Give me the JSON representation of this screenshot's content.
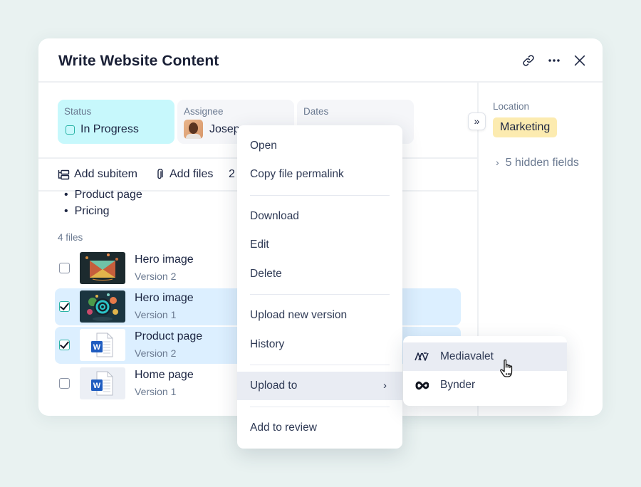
{
  "window": {
    "title": "Write Website Content",
    "actions": [
      {
        "name": "copy-link",
        "icon": "link-icon"
      },
      {
        "name": "more",
        "icon": "more-horizontal-icon"
      },
      {
        "name": "close",
        "icon": "close-icon"
      }
    ]
  },
  "fields": {
    "status": {
      "label": "Status",
      "value": "In Progress",
      "color": "#c7f8fc"
    },
    "assignee": {
      "label": "Assignee",
      "value": "Josep"
    },
    "dates": {
      "label": "Dates",
      "value": ""
    }
  },
  "sidebar": {
    "location_label": "Location",
    "location_value": "Marketing",
    "location_color": "#fcebb0",
    "hidden_fields": "5 hidden fields",
    "collapse_icon": "double-chevron-right-icon"
  },
  "toolbar": {
    "add_subitem": "Add subitem",
    "add_files": "Add files",
    "count": "2"
  },
  "description": {
    "bullets": [
      "Product page",
      "Pricing"
    ]
  },
  "files": {
    "count_label": "4 files",
    "items": [
      {
        "name": "Hero image",
        "version": "Version 2",
        "selected": false,
        "type": "image"
      },
      {
        "name": "Hero image",
        "version": "Version 1",
        "selected": true,
        "type": "image"
      },
      {
        "name": "Product page",
        "version": "Version 2",
        "selected": true,
        "type": "word"
      },
      {
        "name": "Home page",
        "version": "Version 1",
        "selected": false,
        "type": "word"
      }
    ]
  },
  "context_menu": {
    "items": [
      {
        "label": "Open"
      },
      {
        "label": "Copy file permalink"
      },
      {
        "label": "Download"
      },
      {
        "label": "Edit"
      },
      {
        "label": "Delete"
      },
      {
        "label": "Upload new version"
      },
      {
        "label": "History"
      },
      {
        "label": "Upload to",
        "submenu": true,
        "highlighted": true
      },
      {
        "label": "Add to review"
      }
    ]
  },
  "submenu": {
    "items": [
      {
        "label": "Mediavalet",
        "icon": "mediavalet-logo-icon",
        "highlighted": true
      },
      {
        "label": "Bynder",
        "icon": "bynder-logo-icon"
      }
    ]
  }
}
